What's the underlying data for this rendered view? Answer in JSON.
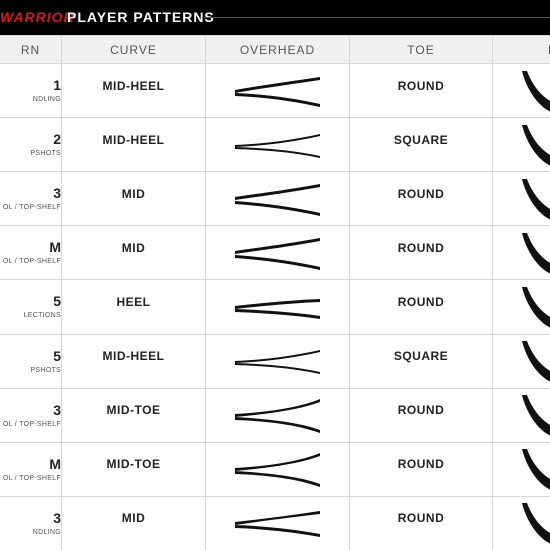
{
  "header": {
    "brand": "WARRIOR",
    "title": "PLAYER PATTERNS"
  },
  "columns": {
    "pattern": "RN",
    "curve": "CURVE",
    "overhead": "OVERHEAD",
    "toe": "TOE",
    "face": "F"
  },
  "rows": [
    {
      "pattern": "1",
      "desc": "NDLING",
      "curve": "MID-HEEL",
      "toe": "ROUND"
    },
    {
      "pattern": "2",
      "desc": "PSHOTS",
      "curve": "MID-HEEL",
      "toe": "SQUARE"
    },
    {
      "pattern": "3",
      "desc": "OL / TOP-SHELF",
      "curve": "MID",
      "toe": "ROUND"
    },
    {
      "pattern": "M",
      "desc": "OL / TOP-SHELF",
      "curve": "MID",
      "toe": "ROUND"
    },
    {
      "pattern": "5",
      "desc": "LECTIONS",
      "curve": "HEEL",
      "toe": "ROUND"
    },
    {
      "pattern": "5",
      "desc": "PSHOTS",
      "curve": "MID-HEEL",
      "toe": "SQUARE"
    },
    {
      "pattern": "3",
      "desc": "OL / TOP-SHELF",
      "curve": "MID-TOE",
      "toe": "ROUND"
    },
    {
      "pattern": "M",
      "desc": "OL / TOP-SHELF",
      "curve": "MID-TOE",
      "toe": "ROUND"
    },
    {
      "pattern": "3",
      "desc": "NDLING",
      "curve": "MID",
      "toe": "ROUND"
    }
  ],
  "colors": {
    "brand_red": "#d7191f",
    "bar_bg": "#000000",
    "grid_line": "#d9d9d9",
    "head_bg": "#f0f0f0"
  }
}
